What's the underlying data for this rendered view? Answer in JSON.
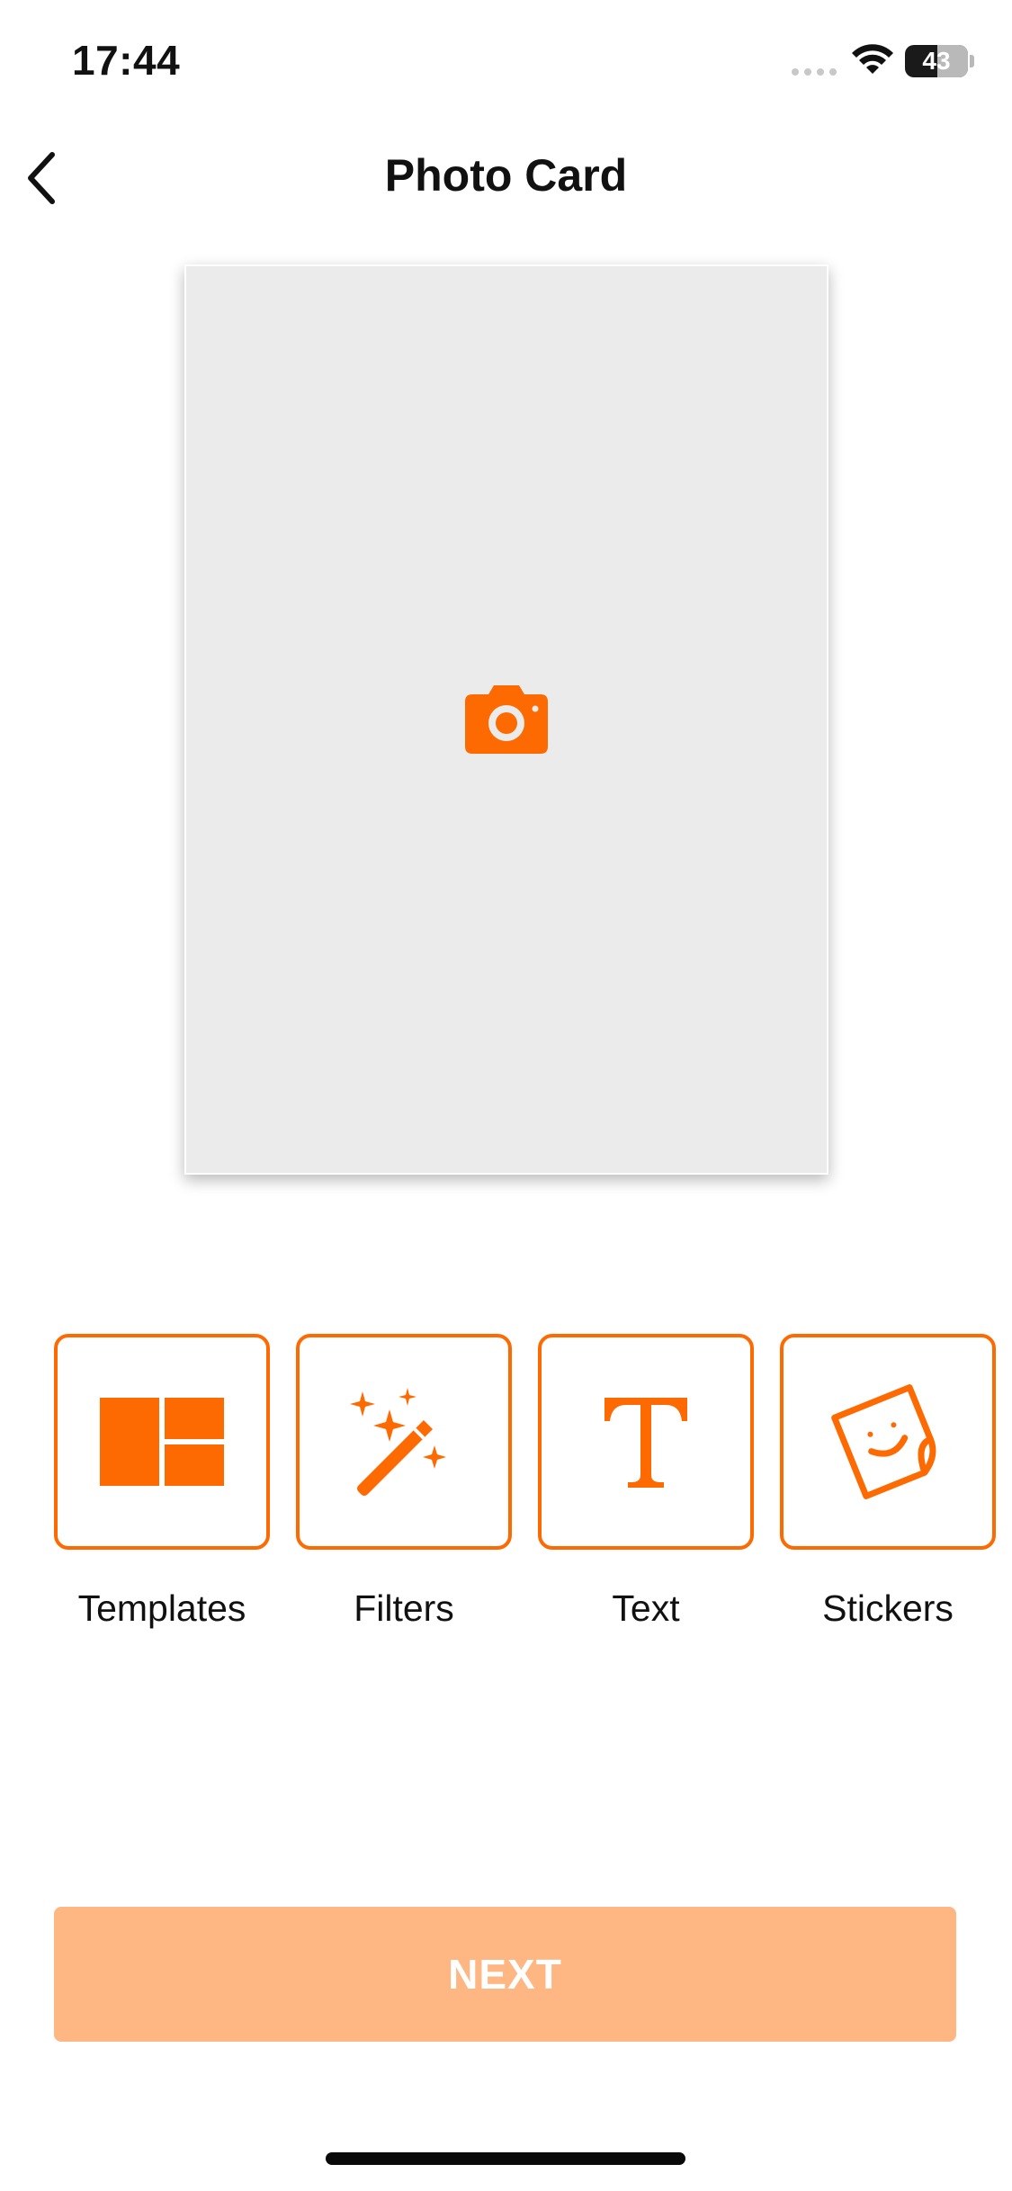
{
  "status_bar": {
    "time": "17:44",
    "battery_level": "43"
  },
  "nav": {
    "title": "Photo Card",
    "back_icon": "chevron-left-icon"
  },
  "canvas": {
    "icon": "camera-icon",
    "background": "#ebebeb"
  },
  "tools": [
    {
      "label": "Templates",
      "icon": "templates-grid-icon"
    },
    {
      "label": "Filters",
      "icon": "magic-wand-icon"
    },
    {
      "label": "Text",
      "icon": "text-t-icon"
    },
    {
      "label": "Stickers",
      "icon": "sticker-smiley-icon"
    }
  ],
  "footer": {
    "next_label": "NEXT"
  },
  "colors": {
    "accent": "#fe6a02",
    "next_button_disabled": "#feb682"
  }
}
